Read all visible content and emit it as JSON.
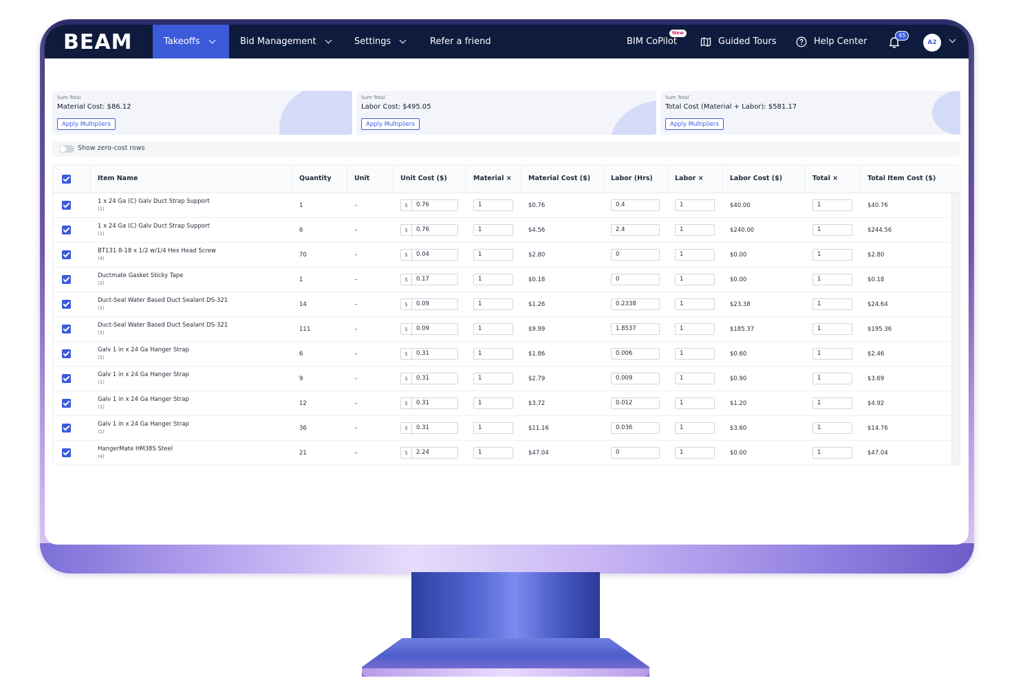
{
  "nav": {
    "logo": "BEAM",
    "takeoffs": "Takeoffs",
    "bid_management": "Bid Management",
    "settings": "Settings",
    "refer": "Refer a friend",
    "copilot": "BIM CoPilot",
    "copilot_badge": "New",
    "guided_tours": "Guided Tours",
    "help_center": "Help Center",
    "notification_count": "45",
    "avatar_initials": "A2"
  },
  "summary": [
    {
      "label": "Sum Total",
      "value": "Material Cost: $86.12",
      "button": "Apply Multipliers"
    },
    {
      "label": "Sum Total",
      "value": "Labor Cost: $495.05",
      "button": "Apply Multipliers"
    },
    {
      "label": "Sum Total",
      "value": "Total Cost (Material + Labor): $581.17",
      "button": "Apply Multipliers"
    }
  ],
  "toggle_label": "Show zero-cost rows",
  "columns": [
    "Item Name",
    "Quantity",
    "Unit",
    "Unit Cost ($)",
    "Material ×",
    "Material Cost ($)",
    "Labor (Hrs)",
    "Labor ×",
    "Labor Cost ($)",
    "Total ×",
    "Total Item Cost ($)"
  ],
  "currency_symbol": "$",
  "rows": [
    {
      "name": "1 x 24 Ga (C) Galv Duct Strap Support",
      "count": "(1)",
      "qty": "1",
      "unit": "–",
      "unit_cost": "0.76",
      "mat_mult": "1",
      "mat_cost": "$0.76",
      "labor_hrs": "0.4",
      "labor_mult": "1",
      "labor_cost": "$40.00",
      "total_mult": "1",
      "total": "$40.76"
    },
    {
      "name": "1 x 24 Ga (C) Galv Duct Strap Support",
      "count": "(1)",
      "qty": "6",
      "unit": "–",
      "unit_cost": "0.76",
      "mat_mult": "1",
      "mat_cost": "$4.56",
      "labor_hrs": "2.4",
      "labor_mult": "1",
      "labor_cost": "$240.00",
      "total_mult": "1",
      "total": "$244.56"
    },
    {
      "name": "BT131 8-18 x 1/2 w/1/4 Hex Head Screw",
      "count": "(4)",
      "qty": "70",
      "unit": "–",
      "unit_cost": "0.04",
      "mat_mult": "1",
      "mat_cost": "$2.80",
      "labor_hrs": "0",
      "labor_mult": "1",
      "labor_cost": "$0.00",
      "total_mult": "1",
      "total": "$2.80"
    },
    {
      "name": "Ductmate Gasket Sticky Tape",
      "count": "(2)",
      "qty": "1",
      "unit": "–",
      "unit_cost": "0.17",
      "mat_mult": "1",
      "mat_cost": "$0.18",
      "labor_hrs": "0",
      "labor_mult": "1",
      "labor_cost": "$0.00",
      "total_mult": "1",
      "total": "$0.18"
    },
    {
      "name": "Duct-Seal Water Based Duct Sealant DS-321",
      "count": "(1)",
      "qty": "14",
      "unit": "–",
      "unit_cost": "0.09",
      "mat_mult": "1",
      "mat_cost": "$1.26",
      "labor_hrs": "0.2338",
      "labor_mult": "1",
      "labor_cost": "$23.38",
      "total_mult": "1",
      "total": "$24.64"
    },
    {
      "name": "Duct-Seal Water Based Duct Sealant DS-321",
      "count": "(1)",
      "qty": "111",
      "unit": "–",
      "unit_cost": "0.09",
      "mat_mult": "1",
      "mat_cost": "$9.99",
      "labor_hrs": "1.8537",
      "labor_mult": "1",
      "labor_cost": "$185.37",
      "total_mult": "1",
      "total": "$195.36"
    },
    {
      "name": "Galv 1 in x 24 Ga Hanger Strap",
      "count": "(1)",
      "qty": "6",
      "unit": "–",
      "unit_cost": "0.31",
      "mat_mult": "1",
      "mat_cost": "$1.86",
      "labor_hrs": "0.006",
      "labor_mult": "1",
      "labor_cost": "$0.60",
      "total_mult": "1",
      "total": "$2.46"
    },
    {
      "name": "Galv 1 in x 24 Ga Hanger Strap",
      "count": "(1)",
      "qty": "9",
      "unit": "–",
      "unit_cost": "0.31",
      "mat_mult": "1",
      "mat_cost": "$2.79",
      "labor_hrs": "0.009",
      "labor_mult": "1",
      "labor_cost": "$0.90",
      "total_mult": "1",
      "total": "$3.69"
    },
    {
      "name": "Galv 1 in x 24 Ga Hanger Strap",
      "count": "(1)",
      "qty": "12",
      "unit": "–",
      "unit_cost": "0.31",
      "mat_mult": "1",
      "mat_cost": "$3.72",
      "labor_hrs": "0.012",
      "labor_mult": "1",
      "labor_cost": "$1.20",
      "total_mult": "1",
      "total": "$4.92"
    },
    {
      "name": "Galv 1 in x 24 Ga Hanger Strap",
      "count": "(1)",
      "qty": "36",
      "unit": "–",
      "unit_cost": "0.31",
      "mat_mult": "1",
      "mat_cost": "$11.16",
      "labor_hrs": "0.036",
      "labor_mult": "1",
      "labor_cost": "$3.60",
      "total_mult": "1",
      "total": "$14.76"
    },
    {
      "name": "HangerMate HM38S Steel",
      "count": "(4)",
      "qty": "21",
      "unit": "–",
      "unit_cost": "2.24",
      "mat_mult": "1",
      "mat_cost": "$47.04",
      "labor_hrs": "0",
      "labor_mult": "1",
      "labor_cost": "$0.00",
      "total_mult": "1",
      "total": "$47.04"
    }
  ],
  "colors": {
    "nav_bg": "#0f1b3d",
    "accent": "#3b5bdb"
  }
}
